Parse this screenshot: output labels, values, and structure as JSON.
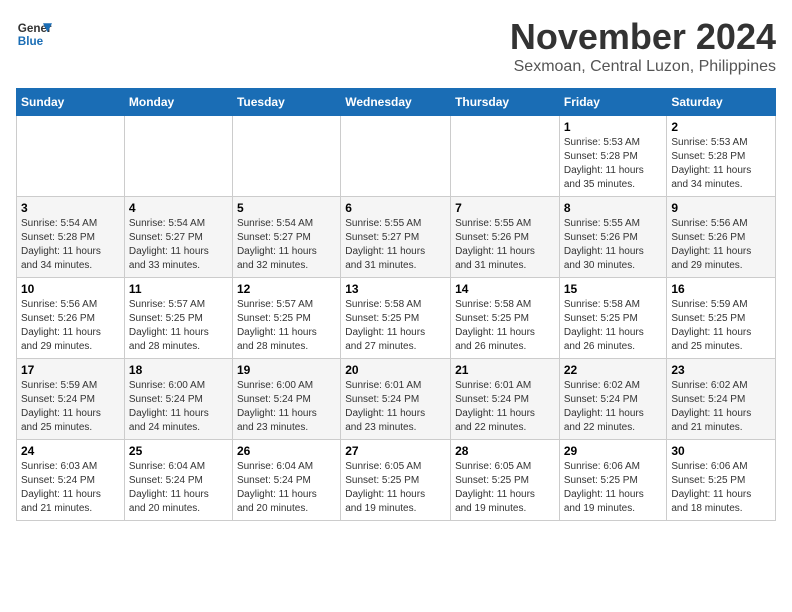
{
  "logo": {
    "line1": "General",
    "line2": "Blue"
  },
  "title": "November 2024",
  "location": "Sexmoan, Central Luzon, Philippines",
  "weekdays": [
    "Sunday",
    "Monday",
    "Tuesday",
    "Wednesday",
    "Thursday",
    "Friday",
    "Saturday"
  ],
  "weeks": [
    [
      {
        "day": "",
        "info": ""
      },
      {
        "day": "",
        "info": ""
      },
      {
        "day": "",
        "info": ""
      },
      {
        "day": "",
        "info": ""
      },
      {
        "day": "",
        "info": ""
      },
      {
        "day": "1",
        "info": "Sunrise: 5:53 AM\nSunset: 5:28 PM\nDaylight: 11 hours\nand 35 minutes."
      },
      {
        "day": "2",
        "info": "Sunrise: 5:53 AM\nSunset: 5:28 PM\nDaylight: 11 hours\nand 34 minutes."
      }
    ],
    [
      {
        "day": "3",
        "info": "Sunrise: 5:54 AM\nSunset: 5:28 PM\nDaylight: 11 hours\nand 34 minutes."
      },
      {
        "day": "4",
        "info": "Sunrise: 5:54 AM\nSunset: 5:27 PM\nDaylight: 11 hours\nand 33 minutes."
      },
      {
        "day": "5",
        "info": "Sunrise: 5:54 AM\nSunset: 5:27 PM\nDaylight: 11 hours\nand 32 minutes."
      },
      {
        "day": "6",
        "info": "Sunrise: 5:55 AM\nSunset: 5:27 PM\nDaylight: 11 hours\nand 31 minutes."
      },
      {
        "day": "7",
        "info": "Sunrise: 5:55 AM\nSunset: 5:26 PM\nDaylight: 11 hours\nand 31 minutes."
      },
      {
        "day": "8",
        "info": "Sunrise: 5:55 AM\nSunset: 5:26 PM\nDaylight: 11 hours\nand 30 minutes."
      },
      {
        "day": "9",
        "info": "Sunrise: 5:56 AM\nSunset: 5:26 PM\nDaylight: 11 hours\nand 29 minutes."
      }
    ],
    [
      {
        "day": "10",
        "info": "Sunrise: 5:56 AM\nSunset: 5:26 PM\nDaylight: 11 hours\nand 29 minutes."
      },
      {
        "day": "11",
        "info": "Sunrise: 5:57 AM\nSunset: 5:25 PM\nDaylight: 11 hours\nand 28 minutes."
      },
      {
        "day": "12",
        "info": "Sunrise: 5:57 AM\nSunset: 5:25 PM\nDaylight: 11 hours\nand 28 minutes."
      },
      {
        "day": "13",
        "info": "Sunrise: 5:58 AM\nSunset: 5:25 PM\nDaylight: 11 hours\nand 27 minutes."
      },
      {
        "day": "14",
        "info": "Sunrise: 5:58 AM\nSunset: 5:25 PM\nDaylight: 11 hours\nand 26 minutes."
      },
      {
        "day": "15",
        "info": "Sunrise: 5:58 AM\nSunset: 5:25 PM\nDaylight: 11 hours\nand 26 minutes."
      },
      {
        "day": "16",
        "info": "Sunrise: 5:59 AM\nSunset: 5:25 PM\nDaylight: 11 hours\nand 25 minutes."
      }
    ],
    [
      {
        "day": "17",
        "info": "Sunrise: 5:59 AM\nSunset: 5:24 PM\nDaylight: 11 hours\nand 25 minutes."
      },
      {
        "day": "18",
        "info": "Sunrise: 6:00 AM\nSunset: 5:24 PM\nDaylight: 11 hours\nand 24 minutes."
      },
      {
        "day": "19",
        "info": "Sunrise: 6:00 AM\nSunset: 5:24 PM\nDaylight: 11 hours\nand 23 minutes."
      },
      {
        "day": "20",
        "info": "Sunrise: 6:01 AM\nSunset: 5:24 PM\nDaylight: 11 hours\nand 23 minutes."
      },
      {
        "day": "21",
        "info": "Sunrise: 6:01 AM\nSunset: 5:24 PM\nDaylight: 11 hours\nand 22 minutes."
      },
      {
        "day": "22",
        "info": "Sunrise: 6:02 AM\nSunset: 5:24 PM\nDaylight: 11 hours\nand 22 minutes."
      },
      {
        "day": "23",
        "info": "Sunrise: 6:02 AM\nSunset: 5:24 PM\nDaylight: 11 hours\nand 21 minutes."
      }
    ],
    [
      {
        "day": "24",
        "info": "Sunrise: 6:03 AM\nSunset: 5:24 PM\nDaylight: 11 hours\nand 21 minutes."
      },
      {
        "day": "25",
        "info": "Sunrise: 6:04 AM\nSunset: 5:24 PM\nDaylight: 11 hours\nand 20 minutes."
      },
      {
        "day": "26",
        "info": "Sunrise: 6:04 AM\nSunset: 5:24 PM\nDaylight: 11 hours\nand 20 minutes."
      },
      {
        "day": "27",
        "info": "Sunrise: 6:05 AM\nSunset: 5:25 PM\nDaylight: 11 hours\nand 19 minutes."
      },
      {
        "day": "28",
        "info": "Sunrise: 6:05 AM\nSunset: 5:25 PM\nDaylight: 11 hours\nand 19 minutes."
      },
      {
        "day": "29",
        "info": "Sunrise: 6:06 AM\nSunset: 5:25 PM\nDaylight: 11 hours\nand 19 minutes."
      },
      {
        "day": "30",
        "info": "Sunrise: 6:06 AM\nSunset: 5:25 PM\nDaylight: 11 hours\nand 18 minutes."
      }
    ]
  ]
}
